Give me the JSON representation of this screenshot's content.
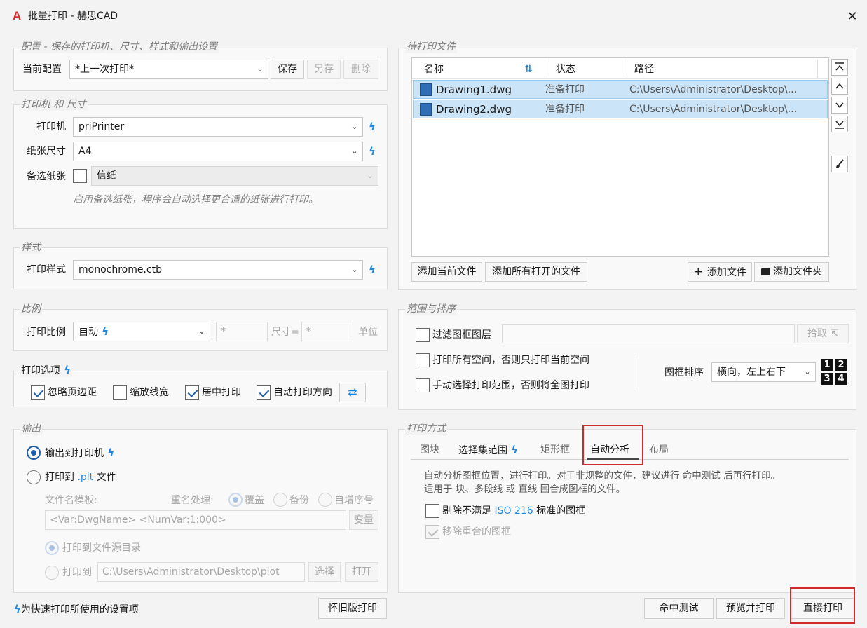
{
  "window": {
    "title": "批量打印 - 赫思CAD",
    "logo_letter": "A",
    "close_symbol": "✕"
  },
  "config": {
    "legend": "配置 - 保存的打印机、尺寸、样式和输出设置",
    "current_label": "当前配置",
    "current_value": "*上一次打印*",
    "save_label": "保存",
    "save_as_label": "另存",
    "delete_label": "删除"
  },
  "printer": {
    "legend": "打印机 和 尺寸",
    "printer_label": "打印机",
    "printer_value": "priPrinter",
    "paper_label": "纸张尺寸",
    "paper_value": "A4",
    "alt_label": "备选纸张",
    "alt_value": "信纸",
    "alt_hint": "启用备选纸张，程序会自动选择更合适的纸张进行打印。"
  },
  "style": {
    "legend": "样式",
    "label": "打印样式",
    "value": "monochrome.ctb"
  },
  "scale": {
    "legend": "比例",
    "label": "打印比例",
    "value": "自动",
    "field1": "*",
    "size_label": "尺寸=",
    "field2": "*",
    "unit_label": "单位"
  },
  "options": {
    "legend": "打印选项",
    "items": [
      {
        "label": "忽略页边距",
        "checked": true
      },
      {
        "label": "缩放线宽",
        "checked": false
      },
      {
        "label": "居中打印",
        "checked": true
      },
      {
        "label": "自动打印方向",
        "checked": true
      }
    ]
  },
  "output": {
    "legend": "输出",
    "to_printer": "输出到打印机",
    "to_file_prefix": "打印到",
    "to_file_ext": ".plt",
    "to_file_suffix": "文件",
    "template_label": "文件名模板:",
    "rename_label": "重名处理:",
    "rename_options": [
      "覆盖",
      "备份",
      "自增序号"
    ],
    "template_value": "<Var:DwgName> <NumVar:1:000>",
    "var_button": "变量",
    "to_source_dir": "打印到文件源目录",
    "to_dir_label": "打印到",
    "dir_value": "C:\\Users\\Administrator\\Desktop\\plot",
    "choose_button": "选择",
    "open_button": "打开"
  },
  "files": {
    "legend": "待打印文件",
    "columns": [
      "名称",
      "状态",
      "路径"
    ],
    "sort_icon": "⇅",
    "rows": [
      {
        "name": "Drawing1.dwg",
        "status": "准备打印",
        "path": "C:\\Users\\Administrator\\Desktop\\..."
      },
      {
        "name": "Drawing2.dwg",
        "status": "准备打印",
        "path": "C:\\Users\\Administrator\\Desktop\\..."
      }
    ],
    "add_current": "添加当前文件",
    "add_all_open": "添加所有打开的文件",
    "add_file": "添加文件",
    "add_folder": "添加文件夹",
    "icons": [
      "move-top-icon",
      "move-up-icon",
      "move-down-icon",
      "move-bottom-icon",
      "brush-icon"
    ]
  },
  "range": {
    "legend": "范围与排序",
    "filter_label": "过滤图框图层",
    "pick_label": "拾取",
    "all_spaces": "打印所有空间，否则只打印当前空间",
    "manual_range": "手动选择打印范围，否则将全图打印",
    "order_label": "图框排序",
    "order_value": "横向，左上右下",
    "grid_digits": [
      "1",
      "2",
      "3",
      "4"
    ]
  },
  "method": {
    "legend": "打印方式",
    "tabs": [
      "图块",
      "选择集范围",
      "矩形框",
      "自动分析",
      "布局"
    ],
    "active_tab": 3,
    "desc_part1": "自动分析图框位置，进行打印。对于非规整的文件，建议进行",
    "desc_link": "命中测试",
    "desc_part2": "后再行打印。",
    "desc_line2_a": "适用于",
    "desc_line2_b": "块、多段线",
    "desc_line2_c": "或",
    "desc_line2_d": "直线",
    "desc_line2_e": "围合成图框的文件。",
    "exclude_prefix": "剔除不满足",
    "exclude_iso": "ISO 216",
    "exclude_suffix": "标准的图框",
    "remove_overlap": "移除重合的图框"
  },
  "footer": {
    "bolt_note": "为快速打印所使用的设置项",
    "legacy_button": "怀旧版打印",
    "hit_test": "命中测试",
    "preview_print": "预览并打印",
    "direct_print": "直接打印"
  },
  "colors": {
    "accent": "#1e88e5",
    "selection": "#cce4f7",
    "highlight_box": "#d12a2a"
  }
}
